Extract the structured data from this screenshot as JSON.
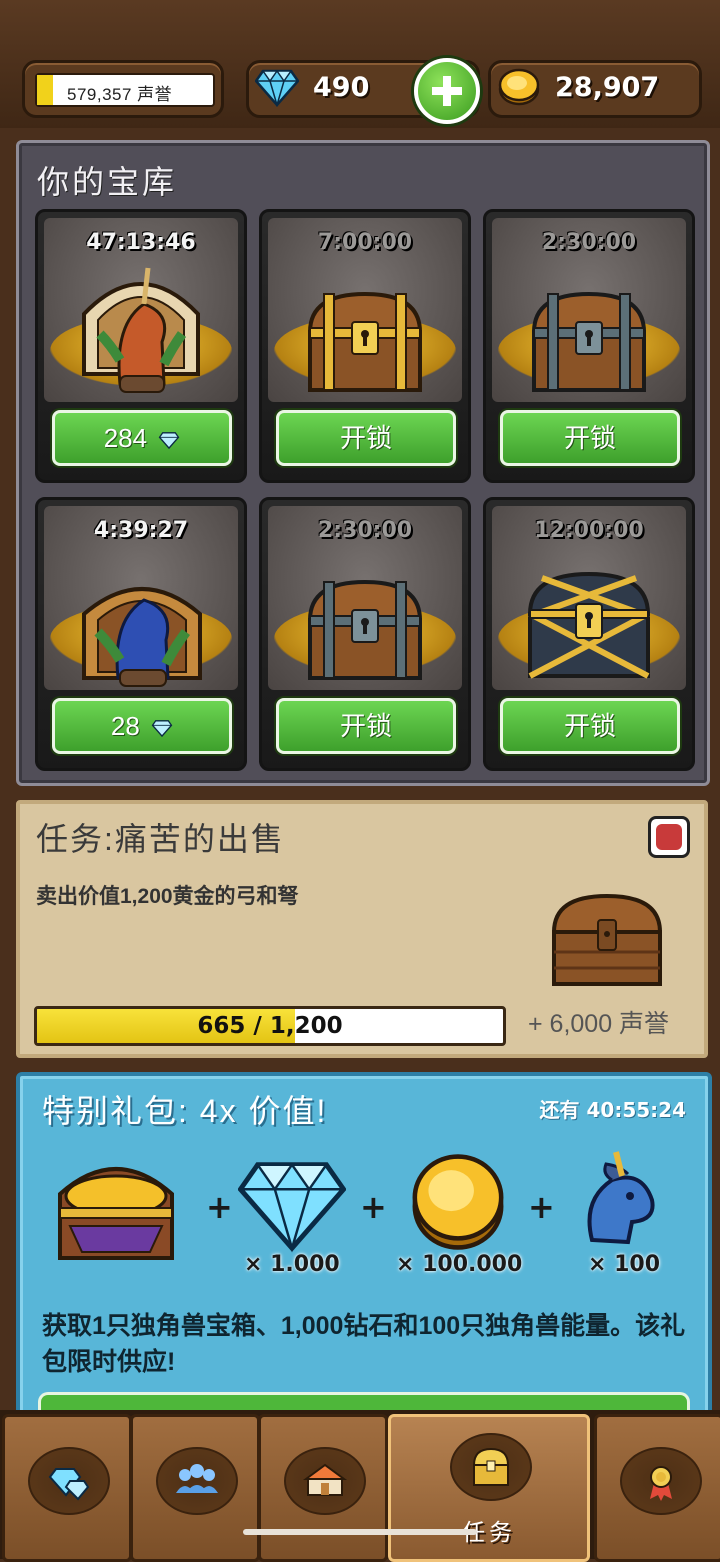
{
  "header": {
    "reputation_text": "579,357 声誉",
    "gems": "490",
    "gold": "28,907"
  },
  "vault": {
    "title": "你的宝库",
    "chests": [
      {
        "timer": "47:13:46",
        "button": "284",
        "button_type": "gems",
        "chest": "unicorn-chest-orange"
      },
      {
        "timer": "7:00:00",
        "button": "开锁",
        "button_type": "unlock",
        "chest": "gold-chest"
      },
      {
        "timer": "2:30:00",
        "button": "开锁",
        "button_type": "unlock",
        "chest": "iron-chest"
      },
      {
        "timer": "4:39:27",
        "button": "28",
        "button_type": "gems",
        "chest": "unicorn-chest-blue"
      },
      {
        "timer": "2:30:00",
        "button": "开锁",
        "button_type": "unlock",
        "chest": "iron-chest"
      },
      {
        "timer": "12:00:00",
        "button": "开锁",
        "button_type": "unlock",
        "chest": "royal-chest"
      }
    ]
  },
  "quest": {
    "title": "任务:痛苦的出售",
    "description": "卖出价值1,200黄金的弓和弩",
    "progress_text": "665 / 1,200",
    "progress_fraction": 0.554,
    "reward": "+ 6,000 声誉"
  },
  "offer": {
    "title": "特别礼包: 4x 价值!",
    "timer": "还有 40:55:24",
    "items": [
      {
        "icon": "unicorn-chest-icon",
        "qty": ""
      },
      {
        "icon": "diamond-icon",
        "qty": "× 1.000"
      },
      {
        "icon": "gold-coin-icon",
        "qty": "× 100.000"
      },
      {
        "icon": "unicorn-head-icon",
        "qty": "× 100"
      }
    ],
    "description": "获取1只独角兽宝箱、1,000钻石和100只独角兽能量。该礼包限时供应!"
  },
  "tabs": [
    {
      "icon": "gems-tab-icon",
      "label": ""
    },
    {
      "icon": "guild-tab-icon",
      "label": ""
    },
    {
      "icon": "shop-tab-icon",
      "label": ""
    },
    {
      "icon": "chest-tab-icon",
      "label": "任务",
      "active": true
    },
    {
      "icon": "achievement-tab-icon",
      "label": ""
    }
  ],
  "colors": {
    "accent_green": "#4eb73a",
    "gold": "#f1d21b",
    "offer_blue": "#58b6d8"
  }
}
